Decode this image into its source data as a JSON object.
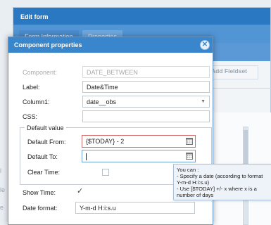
{
  "background": {
    "title": "Edit form",
    "tabs": [
      "Form Information",
      "Properties"
    ],
    "add_fieldset_label": "Add Fieldset",
    "left_fragments": [
      "l",
      "le",
      "e"
    ]
  },
  "dialog": {
    "title": "Component properties",
    "close_icon": "close-icon",
    "component": {
      "label": "Component:",
      "value": "DATE_BETWEEN"
    },
    "label": {
      "label": "Label:",
      "value": "Date&Time"
    },
    "column1": {
      "label": "Column1:",
      "value": "date__obs"
    },
    "css": {
      "label": "CSS:",
      "value": ""
    },
    "default_value": {
      "legend": "Default value",
      "from": {
        "label": "Default From:",
        "value": "{$TODAY} - 2"
      },
      "to": {
        "label": "Default To:",
        "value": ""
      },
      "clear_time": {
        "label": "Clear Time:",
        "checked": false
      }
    },
    "show_time": {
      "label": "Show Time:",
      "checked": true
    },
    "date_format": {
      "label": "Date format:",
      "value": "Y-m-d H:i:s.u"
    }
  },
  "tooltip": {
    "lines": [
      "You can :",
      "- Specify a date (according to format",
      "Y-m-d H:i:s.u)",
      "- Use [$TODAY] +/- x where x is a",
      "number of days"
    ]
  },
  "colors": {
    "title_bar": "#3a86cc",
    "invalid_border": "#d36a6a",
    "focus_border": "#6ca1d6",
    "tooltip_bg": "#eef3f9"
  }
}
